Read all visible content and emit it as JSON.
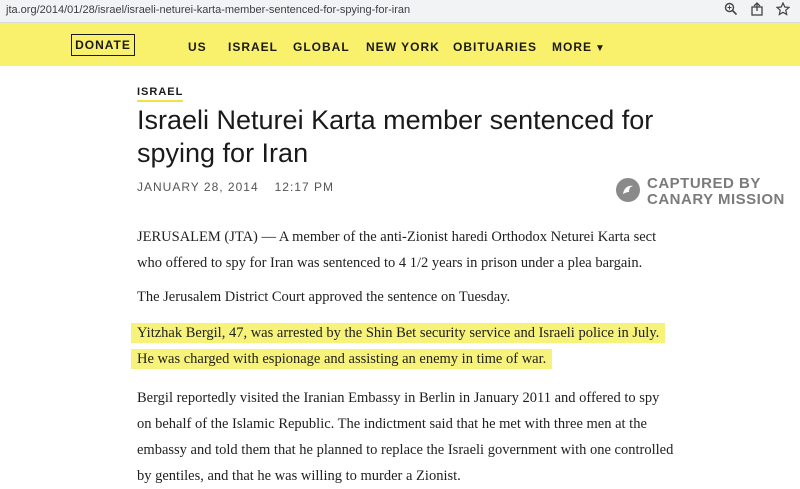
{
  "browser": {
    "url": "jta.org/2014/01/28/israel/israeli-neturei-karta-member-sentenced-for-spying-for-iran",
    "icons": [
      "zoom-icon",
      "share-icon",
      "bookmark-star-icon"
    ]
  },
  "nav": {
    "donate_label": "DONATE",
    "items": [
      "US",
      "ISRAEL",
      "GLOBAL",
      "NEW YORK",
      "OBITUARIES",
      "MORE"
    ],
    "more_caret": "▼",
    "bar_color": "#f9f06b"
  },
  "article": {
    "section": "ISRAEL",
    "headline": "Israeli Neturei Karta member sentenced for spying for Iran",
    "date": "JANUARY 28, 2014",
    "time": "12:17 PM",
    "paragraphs": [
      "JERUSALEM (JTA) — A member of the anti-Zionist haredi Orthodox Neturei Karta sect who offered to spy for Iran was sentenced to 4 1/2 years in prison under a plea bargain.",
      "The Jerusalem District Court approved the sentence on Tuesday.",
      "Yitzhak Bergil, 47, was arrested by the Shin Bet security service and Israeli police in July. He was charged with espionage and assisting an enemy in time of war.",
      "Bergil reportedly visited the Iranian Embassy in Berlin in January 2011 and offered to spy on behalf of the Islamic Republic. The indictment said that he met with three men at the embassy and told them that he planned to replace the Israeli government with one controlled by gentiles, and that he was willing to murder a Zionist."
    ],
    "highlight_color": "#f6f27a"
  },
  "watermark": {
    "line1": "CAPTURED BY",
    "line2": "CANARY MISSION"
  }
}
